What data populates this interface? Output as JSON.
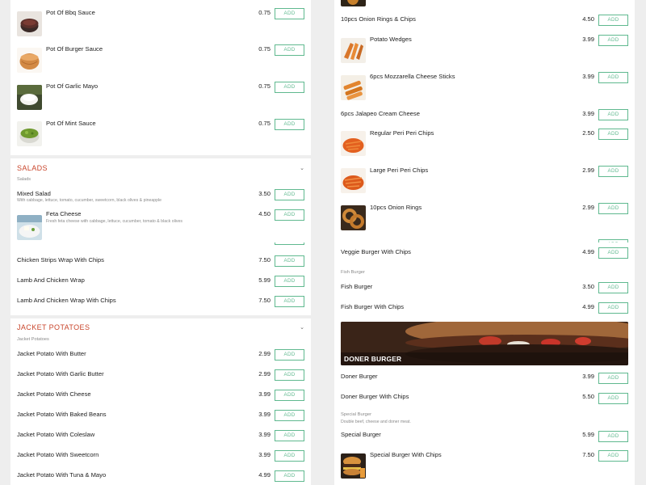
{
  "accent_color": "#c9462c",
  "add_color": "#5fb98f",
  "add_label": "ADD",
  "top_left": {
    "items": [
      {
        "name": "Pot Of Bbq Sauce",
        "price": "0.75",
        "image": "bbq-sauce-image"
      },
      {
        "name": "Pot Of Burger Sauce",
        "price": "0.75",
        "image": "burger-sauce-image"
      },
      {
        "name": "Pot Of Garlic Mayo",
        "price": "0.75",
        "image": "garlic-mayo-image"
      },
      {
        "name": "Pot Of Mint Sauce",
        "price": "0.75",
        "image": "mint-sauce-image"
      }
    ],
    "salads": {
      "title": "SALADS",
      "subtitle": "Salads",
      "items": [
        {
          "name": "Mixed Salad",
          "desc": "With cabbage, lettuce, tomato, cucumber, sweetcorn, black olives & pineapple",
          "price": "3.50"
        },
        {
          "name": "Feta Cheese",
          "desc": "Fresh feta cheese with cabbage, lettuce, cucumber, tomato & black olives",
          "price": "4.50",
          "image": "feta-salad-image"
        }
      ]
    }
  },
  "top_right": {
    "items": [
      {
        "name": "10pcs Onion Rings & Chips",
        "price": "4.50"
      },
      {
        "name": "Potato Wedges",
        "price": "3.99",
        "image": "potato-wedges-image"
      },
      {
        "name": "6pcs Mozzarella Cheese Sticks",
        "price": "3.99",
        "image": "cheese-sticks-image"
      },
      {
        "name": "6pcs Jalapeo Cream Cheese",
        "price": "3.99"
      },
      {
        "name": "Regular Peri Peri Chips",
        "price": "2.50",
        "image": "peri-chips-image"
      },
      {
        "name": "Large Peri Peri Chips",
        "price": "2.99",
        "image": "large-peri-chips-image"
      },
      {
        "name": "10pcs Onion Rings",
        "price": "2.99",
        "image": "onion-rings-image"
      }
    ]
  },
  "bottom_left": {
    "items": [
      {
        "name": "Chicken Strips Wrap With Chips",
        "price": "7.50"
      },
      {
        "name": "Lamb And Chicken Wrap",
        "price": "5.99"
      },
      {
        "name": "Lamb And Chicken Wrap With Chips",
        "price": "7.50"
      }
    ],
    "jacket": {
      "title": "JACKET POTATOES",
      "subtitle": "Jacket Potatoes",
      "items": [
        {
          "name": "Jacket Potato With Butter",
          "price": "2.99"
        },
        {
          "name": "Jacket Potato With Garlic Butter",
          "price": "2.99"
        },
        {
          "name": "Jacket Potato With Cheese",
          "price": "3.99"
        },
        {
          "name": "Jacket Potato With Baked Beans",
          "price": "3.99"
        },
        {
          "name": "Jacket Potato With Coleslaw",
          "price": "3.99"
        },
        {
          "name": "Jacket Potato With Sweetcorn",
          "price": "3.99"
        },
        {
          "name": "Jacket Potato With Tuna & Mayo",
          "price": "4.99"
        }
      ]
    }
  },
  "bottom_right": {
    "veggie": {
      "name": "Veggie Burger With Chips",
      "price": "4.99"
    },
    "fish_sub": "Fish Burger",
    "fish_items": [
      {
        "name": "Fish Burger",
        "price": "3.50"
      },
      {
        "name": "Fish Burger With Chips",
        "price": "4.99"
      }
    ],
    "banner_label": "DONER BURGER",
    "doner_items": [
      {
        "name": "Doner Burger",
        "price": "3.99"
      },
      {
        "name": "Doner Burger With Chips",
        "price": "5.50"
      }
    ],
    "special_sub": "Special Burger",
    "special_desc": "Double beef, cheese and doner meat.",
    "special_items": [
      {
        "name": "Special Burger",
        "price": "5.99"
      },
      {
        "name": "Special Burger With Chips",
        "price": "7.50",
        "image": "special-burger-image"
      }
    ]
  }
}
